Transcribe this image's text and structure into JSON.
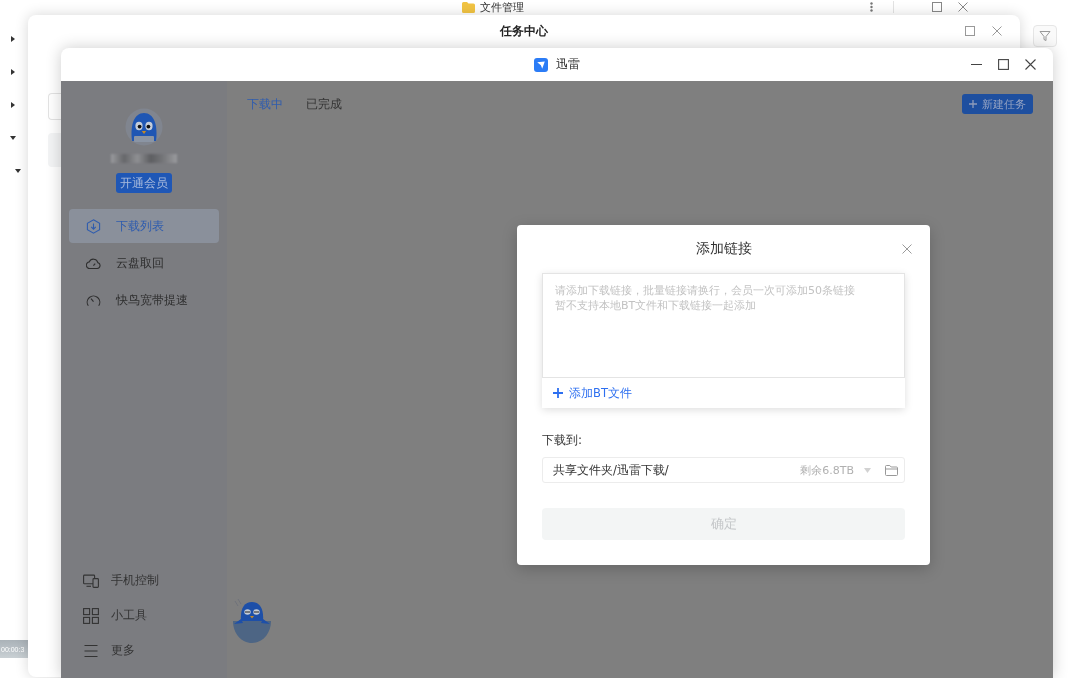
{
  "file_manager_window": {
    "title": "文件管理",
    "tree_items": [
      {
        "expanded": false
      },
      {
        "expanded": false
      },
      {
        "expanded": false
      },
      {
        "expanded": true,
        "children": [
          {
            "expanded": true
          }
        ]
      }
    ],
    "video_duration": "00:00:3"
  },
  "task_center_window": {
    "title": "任务中心"
  },
  "xunlei_window": {
    "title": "迅雷",
    "sidebar": {
      "vip_button": "开通会员",
      "items": [
        {
          "label": "下载列表",
          "selected": true
        },
        {
          "label": "云盘取回",
          "selected": false
        },
        {
          "label": "快鸟宽带提速",
          "selected": false
        }
      ],
      "bottom_items": [
        {
          "label": "手机控制"
        },
        {
          "label": "小工具"
        },
        {
          "label": "更多"
        }
      ]
    },
    "tabs": [
      {
        "label": "下载中",
        "selected": true
      },
      {
        "label": "已完成",
        "selected": false
      }
    ],
    "new_task_button": "新建任务"
  },
  "dialog": {
    "title": "添加链接",
    "links_field": {
      "placeholder": "请添加下载链接，批量链接请换行，会员一次可添加50条链接暂不支持本地BT文件和下载链接一起添加"
    },
    "add_bt_file_button": "添加BT文件",
    "save_to_label": "下载到:",
    "save_path": {
      "value": "共享文件夹/迅雷下载/",
      "free_space": "剩余6.8TB"
    },
    "confirm_button": {
      "label": "确定",
      "disabled": true
    }
  }
}
